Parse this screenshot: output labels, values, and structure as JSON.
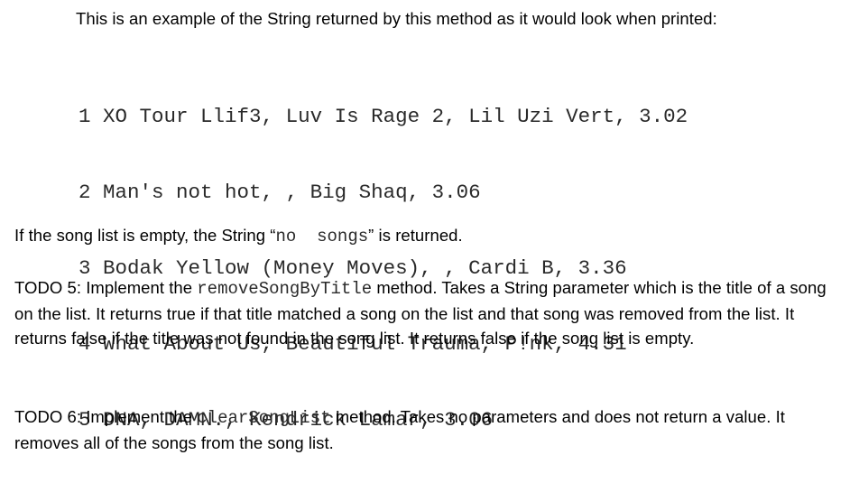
{
  "document": {
    "background_color": "#ffffff",
    "text_color": "#000000",
    "code_color": "#2a2a2a"
  },
  "intro": {
    "text": "This is an example of the String returned by this method as it would look when printed:"
  },
  "code_sample": {
    "lines": [
      {
        "number": "1",
        "text": "XO Tour Llif3, Luv Is Rage 2, Lil Uzi Vert, 3.02"
      },
      {
        "number": "2",
        "text": "Man's not hot, , Big Shaq, 3.06"
      },
      {
        "number": "3",
        "text": "Bodak Yellow (Money Moves), , Cardi B, 3.36"
      },
      {
        "number": "4",
        "text": "What About Us, Beautiful Trauma, P!nk, 4.31"
      },
      {
        "number": "5",
        "text": "DNA, DAMN., Kendrick Lamar, 3.06"
      }
    ]
  },
  "empty_note": {
    "before": "If the song list is empty, the String “",
    "code": "no  songs",
    "after": "” is returned."
  },
  "todo5": {
    "before": "TODO 5: Implement the ",
    "code": "removeSongByTitle",
    "after": " method. Takes a String parameter which is the title of a song on the list. It returns true if that title matched a song on the list and that song was removed from the list. It returns false if the title was not found in the song list. It returns false if the song list is empty."
  },
  "todo6": {
    "before": "TODO 6: Implement the ",
    "code": "clearSongList",
    "after": " method. Takes no parameters and does not return a value. It removes all of the songs from the song list."
  }
}
